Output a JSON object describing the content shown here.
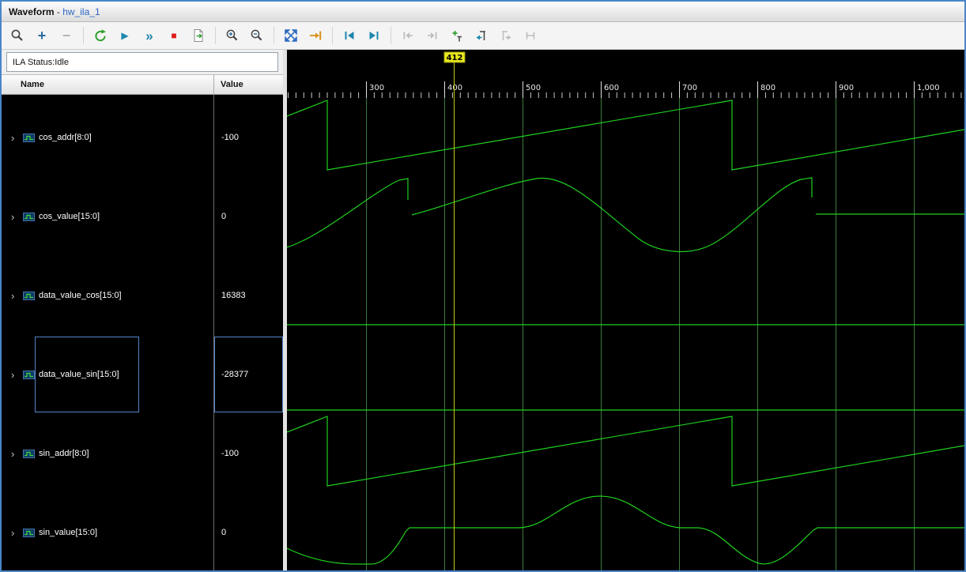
{
  "window": {
    "title": {
      "app": "Waveform",
      "separator": " - ",
      "instance": "hw_ila_1"
    }
  },
  "toolbar": {
    "icons": [
      {
        "name": "find",
        "enabled": true
      },
      {
        "name": "add",
        "glyph": "+",
        "enabled": true
      },
      {
        "name": "remove",
        "glyph": "−",
        "enabled": false
      },
      {
        "name": "auto-re-trigger",
        "enabled": true
      },
      {
        "name": "run-trigger",
        "glyph": "▶",
        "enabled": true
      },
      {
        "name": "run-trigger-immediate",
        "glyph": "»",
        "enabled": true
      },
      {
        "name": "stop-trigger",
        "glyph": "■",
        "enabled": true
      },
      {
        "name": "export-ila-data",
        "enabled": true
      },
      {
        "name": "zoom-in",
        "enabled": true
      },
      {
        "name": "zoom-out",
        "enabled": true
      },
      {
        "name": "zoom-fit",
        "enabled": true
      },
      {
        "name": "zoom-to-cursor",
        "enabled": true
      },
      {
        "name": "go-to-start",
        "enabled": true
      },
      {
        "name": "go-to-end",
        "enabled": true
      },
      {
        "name": "previous-transition",
        "enabled": false
      },
      {
        "name": "next-transition",
        "enabled": false
      },
      {
        "name": "add-marker",
        "enabled": true
      },
      {
        "name": "go-to-marker",
        "enabled": true
      },
      {
        "name": "next-marker",
        "enabled": false
      },
      {
        "name": "swap-markers",
        "enabled": false
      }
    ]
  },
  "status": {
    "text": "ILA Status:Idle"
  },
  "grid": {
    "columns": [
      "Name",
      "Value"
    ],
    "expand_glyph": "›",
    "signals": [
      {
        "name": "cos_addr[8:0]",
        "value": "-100",
        "selected": false
      },
      {
        "name": "cos_value[15:0]",
        "value": "0",
        "selected": false
      },
      {
        "name": "data_value_cos[15:0]",
        "value": "16383",
        "selected": false
      },
      {
        "name": "data_value_sin[15:0]",
        "value": "-28377",
        "selected": true
      },
      {
        "name": "sin_addr[8:0]",
        "value": "-100",
        "selected": false
      },
      {
        "name": "sin_value[15:0]",
        "value": "0",
        "selected": false
      }
    ]
  },
  "waveform": {
    "cursor_time": "412",
    "ruler_labels": [
      "300",
      "400",
      "500",
      "600",
      "700",
      "800",
      "900",
      "1,000"
    ],
    "colors": {
      "trace": "#1fd01f",
      "gridline": "#3c7a3c",
      "cursor": "#c9c918",
      "cursor_flag": "#e8e81e",
      "background": "#000000"
    },
    "traces": [
      {
        "signal": "cos_addr[8:0]",
        "shape": "sawtooth-ramp"
      },
      {
        "signal": "cos_value[15:0]",
        "shape": "cosine"
      },
      {
        "signal": "data_value_cos[15:0]",
        "shape": "constant"
      },
      {
        "signal": "data_value_sin[15:0]",
        "shape": "constant"
      },
      {
        "signal": "sin_addr[8:0]",
        "shape": "sawtooth-ramp"
      },
      {
        "signal": "sin_value[15:0]",
        "shape": "sine"
      }
    ]
  }
}
